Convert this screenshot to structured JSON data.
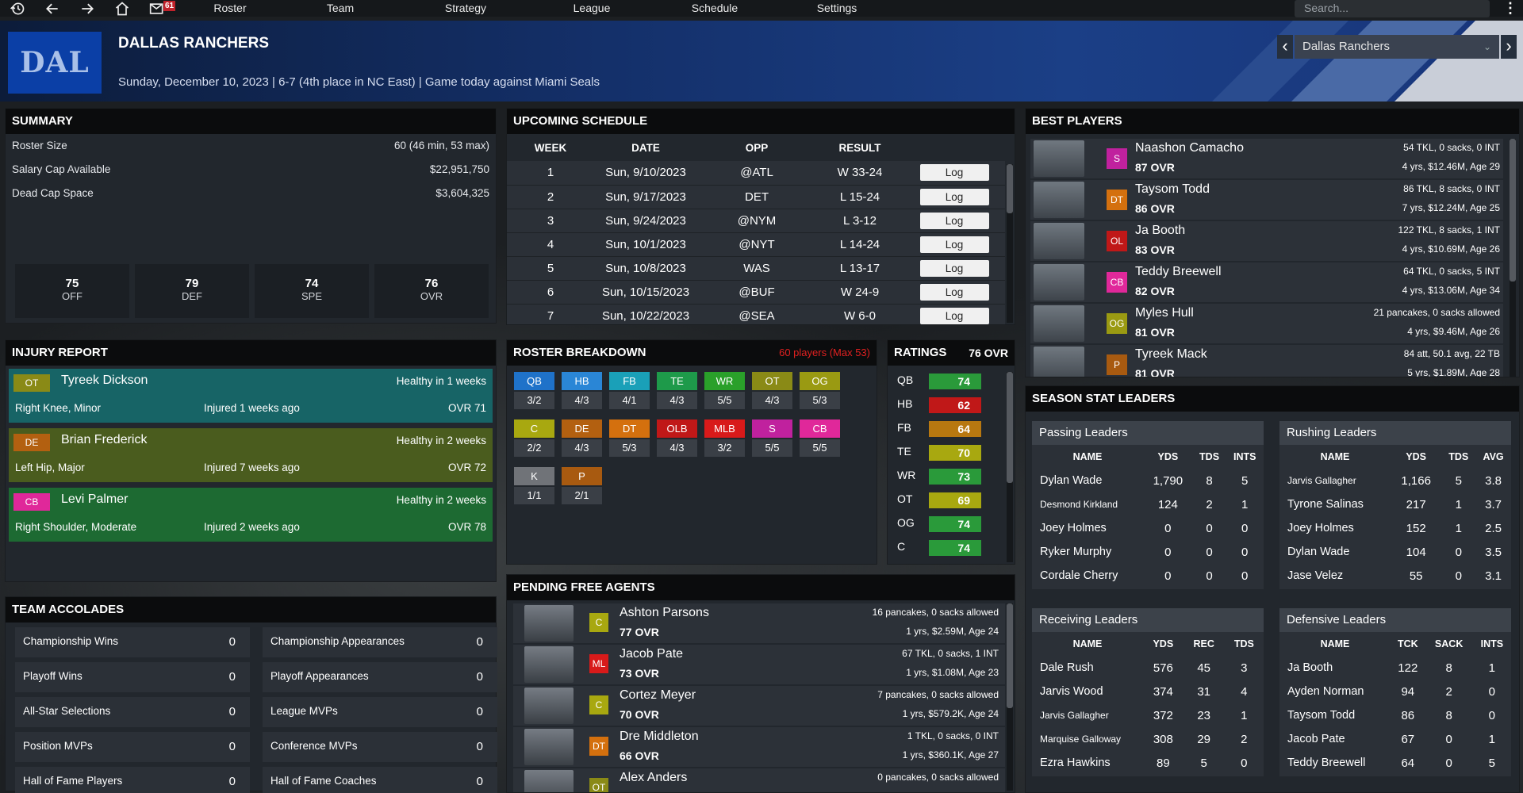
{
  "nav": {
    "mail_count": "61",
    "links": [
      "Roster",
      "Team",
      "Strategy",
      "League",
      "Schedule",
      "Settings"
    ],
    "search_placeholder": "Search..."
  },
  "header": {
    "logo_text": "DAL",
    "team_name": "DALLAS RANCHERS",
    "subtitle": "Sunday, December 10, 2023 | 6-7 (4th place in NC East)  | Game today against Miami Seals",
    "team_select": "Dallas Ranchers"
  },
  "summary": {
    "title": "SUMMARY",
    "rows": [
      {
        "label": "Roster Size",
        "value": "60 (46 min, 53 max)"
      },
      {
        "label": "Salary Cap Available",
        "value": "$22,951,750"
      },
      {
        "label": "Dead Cap Space",
        "value": "$3,604,325"
      }
    ],
    "ratings": [
      {
        "value": "75",
        "label": "OFF"
      },
      {
        "value": "79",
        "label": "DEF"
      },
      {
        "value": "74",
        "label": "SPE"
      },
      {
        "value": "76",
        "label": "OVR"
      }
    ]
  },
  "schedule": {
    "title": "UPCOMING SCHEDULE",
    "headers": [
      "WEEK",
      "DATE",
      "OPP",
      "RESULT"
    ],
    "button_label": "Log",
    "rows": [
      {
        "week": "1",
        "date": "Sun, 9/10/2023",
        "opp": "@ATL",
        "result": "W 33-24"
      },
      {
        "week": "2",
        "date": "Sun, 9/17/2023",
        "opp": "DET",
        "result": "L 15-24"
      },
      {
        "week": "3",
        "date": "Sun, 9/24/2023",
        "opp": "@NYM",
        "result": "L 3-12"
      },
      {
        "week": "4",
        "date": "Sun, 10/1/2023",
        "opp": "@NYT",
        "result": "L 14-24"
      },
      {
        "week": "5",
        "date": "Sun, 10/8/2023",
        "opp": "WAS",
        "result": "L 13-17"
      },
      {
        "week": "6",
        "date": "Sun, 10/15/2023",
        "opp": "@BUF",
        "result": "W 24-9"
      },
      {
        "week": "7",
        "date": "Sun, 10/22/2023",
        "opp": "@SEA",
        "result": "W 6-0"
      }
    ]
  },
  "best_players": {
    "title": "BEST PLAYERS",
    "players": [
      {
        "pos": "S",
        "pos_color": "#c0219e",
        "name": "Naashon Camacho",
        "ovr": "87 OVR",
        "stat": "54 TKL, 0 sacks, 0 INT",
        "contract": "4 yrs, $12.46M, Age 29"
      },
      {
        "pos": "DT",
        "pos_color": "#d4700e",
        "name": "Taysom Todd",
        "ovr": "86 OVR",
        "stat": "86 TKL, 8 sacks, 0 INT",
        "contract": "7 yrs, $12.24M, Age 25"
      },
      {
        "pos": "OL",
        "pos_color": "#c01818",
        "name": "Ja Booth",
        "ovr": "83 OVR",
        "stat": "122 TKL, 8 sacks, 1 INT",
        "contract": "4 yrs, $10.69M, Age 26"
      },
      {
        "pos": "CB",
        "pos_color": "#e0289a",
        "name": "Teddy Breewell",
        "ovr": "82 OVR",
        "stat": "64 TKL, 0 sacks, 5 INT",
        "contract": "4 yrs, $13.06M, Age 34"
      },
      {
        "pos": "OG",
        "pos_color": "#9a9a12",
        "name": "Myles Hull",
        "ovr": "81 OVR",
        "stat": "21 pancakes, 0 sacks allowed",
        "contract": "4 yrs, $9.46M, Age 26"
      },
      {
        "pos": "P",
        "pos_color": "#a85a10",
        "name": "Tyreek Mack",
        "ovr": "81 OVR",
        "stat": "84 att, 50.1 avg, 22 TB",
        "contract": "5 yrs, $1.89M, Age 28"
      }
    ]
  },
  "injury": {
    "title": "INJURY REPORT",
    "rows": [
      {
        "pos": "OT",
        "pos_color": "#8a8a16",
        "bg": "#176466",
        "name": "Tyreek Dickson",
        "healthy": "Healthy in 1 weeks",
        "desc": "Right Knee, Minor",
        "ago": "Injured 1 weeks ago",
        "ovr": "OVR 71"
      },
      {
        "pos": "DE",
        "pos_color": "#b36010",
        "bg": "#4a5c1e",
        "name": "Brian Frederick",
        "healthy": "Healthy in 2 weeks",
        "desc": "Left Hip, Major",
        "ago": "Injured 7 weeks ago",
        "ovr": "OVR 72"
      },
      {
        "pos": "CB",
        "pos_color": "#e0289a",
        "bg": "#1d6a32",
        "name": "Levi Palmer",
        "healthy": "Healthy in 2 weeks",
        "desc": "Right Shoulder, Moderate",
        "ago": "Injured 2 weeks ago",
        "ovr": "OVR 78"
      }
    ]
  },
  "roster_breakdown": {
    "title": "ROSTER BREAKDOWN",
    "count_note": "60 players (Max 53)",
    "positions": [
      {
        "pos": "QB",
        "count": "3/2",
        "color": "#1f72c9"
      },
      {
        "pos": "HB",
        "count": "4/3",
        "color": "#2a86d6"
      },
      {
        "pos": "FB",
        "count": "4/1",
        "color": "#1aa0b8"
      },
      {
        "pos": "TE",
        "count": "4/3",
        "color": "#1e9a4a"
      },
      {
        "pos": "WR",
        "count": "5/5",
        "color": "#2aa02a"
      },
      {
        "pos": "OT",
        "count": "4/3",
        "color": "#8a8a16"
      },
      {
        "pos": "OG",
        "count": "5/3",
        "color": "#9a9a12"
      },
      {
        "pos": "C",
        "count": "2/2",
        "color": "#a8a810"
      },
      {
        "pos": "DE",
        "count": "4/3",
        "color": "#b36010"
      },
      {
        "pos": "DT",
        "count": "5/3",
        "color": "#d4700e"
      },
      {
        "pos": "OLB",
        "count": "4/3",
        "color": "#c01818"
      },
      {
        "pos": "MLB",
        "count": "3/2",
        "color": "#d81a1a"
      },
      {
        "pos": "S",
        "count": "5/5",
        "color": "#c0219e"
      },
      {
        "pos": "CB",
        "count": "5/5",
        "color": "#e0289a"
      },
      {
        "pos": "K",
        "count": "1/1",
        "color": "#707378"
      },
      {
        "pos": "P",
        "count": "2/1",
        "color": "#a85a10"
      }
    ]
  },
  "ratings": {
    "title": "RATINGS",
    "overall": "76 OVR",
    "rows": [
      {
        "pos": "QB",
        "value": "74",
        "color": "#2a9a3a"
      },
      {
        "pos": "HB",
        "value": "62",
        "color": "#c01818"
      },
      {
        "pos": "FB",
        "value": "64",
        "color": "#b87810"
      },
      {
        "pos": "TE",
        "value": "70",
        "color": "#a8a810"
      },
      {
        "pos": "WR",
        "value": "73",
        "color": "#2a9a3a"
      },
      {
        "pos": "OT",
        "value": "69",
        "color": "#a8a810"
      },
      {
        "pos": "OG",
        "value": "74",
        "color": "#2a9a3a"
      },
      {
        "pos": "C",
        "value": "74",
        "color": "#2a9a3a"
      }
    ]
  },
  "accolades": {
    "title": "TEAM ACCOLADES",
    "items": [
      {
        "label": "Championship Wins",
        "value": "0"
      },
      {
        "label": "Championship Appearances",
        "value": "0"
      },
      {
        "label": "Playoff Wins",
        "value": "0"
      },
      {
        "label": "Playoff Appearances",
        "value": "0"
      },
      {
        "label": "All-Star Selections",
        "value": "0"
      },
      {
        "label": "League MVPs",
        "value": "0"
      },
      {
        "label": "Position MVPs",
        "value": "0"
      },
      {
        "label": "Conference MVPs",
        "value": "0"
      },
      {
        "label": "Hall of Fame Players",
        "value": "0"
      },
      {
        "label": "Hall of Fame Coaches",
        "value": "0"
      }
    ]
  },
  "free_agents": {
    "title": "PENDING FREE AGENTS",
    "players": [
      {
        "pos": "C",
        "pos_color": "#a8a810",
        "name": "Ashton Parsons",
        "ovr": "77 OVR",
        "stat": "16 pancakes, 0 sacks allowed",
        "contract": "1 yrs, $2.59M, Age 24"
      },
      {
        "pos": "ML",
        "pos_color": "#d81a1a",
        "name": "Jacob Pate",
        "ovr": "73 OVR",
        "stat": "67 TKL, 0 sacks, 1 INT",
        "contract": "1 yrs, $1.08M, Age 23"
      },
      {
        "pos": "C",
        "pos_color": "#a8a810",
        "name": "Cortez Meyer",
        "ovr": "70 OVR",
        "stat": "7 pancakes, 0 sacks allowed",
        "contract": "1 yrs, $579.2K, Age 24"
      },
      {
        "pos": "DT",
        "pos_color": "#d4700e",
        "name": "Dre Middleton",
        "ovr": "66 OVR",
        "stat": "1 TKL, 0 sacks, 0 INT",
        "contract": "1 yrs, $360.1K, Age 27"
      },
      {
        "pos": "OT",
        "pos_color": "#8a8a16",
        "name": "Alex Anders",
        "ovr": "",
        "stat": "0 pancakes, 0 sacks allowed",
        "contract": ""
      }
    ]
  },
  "stat_leaders": {
    "title": "SEASON STAT LEADERS",
    "passing": {
      "title": "Passing Leaders",
      "headers": [
        "NAME",
        "YDS",
        "TDS",
        "INTS"
      ],
      "rows": [
        [
          "Dylan Wade",
          "1,790",
          "8",
          "5"
        ],
        [
          "Desmond Kirkland",
          "124",
          "2",
          "1"
        ],
        [
          "Joey Holmes",
          "0",
          "0",
          "0"
        ],
        [
          "Ryker Murphy",
          "0",
          "0",
          "0"
        ],
        [
          "Cordale Cherry",
          "0",
          "0",
          "0"
        ]
      ]
    },
    "rushing": {
      "title": "Rushing Leaders",
      "headers": [
        "NAME",
        "YDS",
        "TDS",
        "AVG"
      ],
      "rows": [
        [
          "Jarvis Gallagher",
          "1,166",
          "5",
          "3.8"
        ],
        [
          "Tyrone Salinas",
          "217",
          "1",
          "3.7"
        ],
        [
          "Joey Holmes",
          "152",
          "1",
          "2.5"
        ],
        [
          "Dylan Wade",
          "104",
          "0",
          "3.5"
        ],
        [
          "Jase Velez",
          "55",
          "0",
          "3.1"
        ]
      ]
    },
    "receiving": {
      "title": "Receiving Leaders",
      "headers": [
        "NAME",
        "YDS",
        "REC",
        "TDS"
      ],
      "rows": [
        [
          "Dale Rush",
          "576",
          "45",
          "3"
        ],
        [
          "Jarvis Wood",
          "374",
          "31",
          "4"
        ],
        [
          "Jarvis Gallagher",
          "372",
          "23",
          "1"
        ],
        [
          "Marquise Galloway",
          "308",
          "29",
          "2"
        ],
        [
          "Ezra Hawkins",
          "89",
          "5",
          "0"
        ]
      ]
    },
    "defensive": {
      "title": "Defensive Leaders",
      "headers": [
        "NAME",
        "TCK",
        "SACK",
        "INTS"
      ],
      "rows": [
        [
          "Ja Booth",
          "122",
          "8",
          "1"
        ],
        [
          "Ayden Norman",
          "94",
          "2",
          "0"
        ],
        [
          "Taysom Todd",
          "86",
          "8",
          "0"
        ],
        [
          "Jacob Pate",
          "67",
          "0",
          "1"
        ],
        [
          "Teddy Breewell",
          "64",
          "0",
          "5"
        ]
      ]
    }
  }
}
